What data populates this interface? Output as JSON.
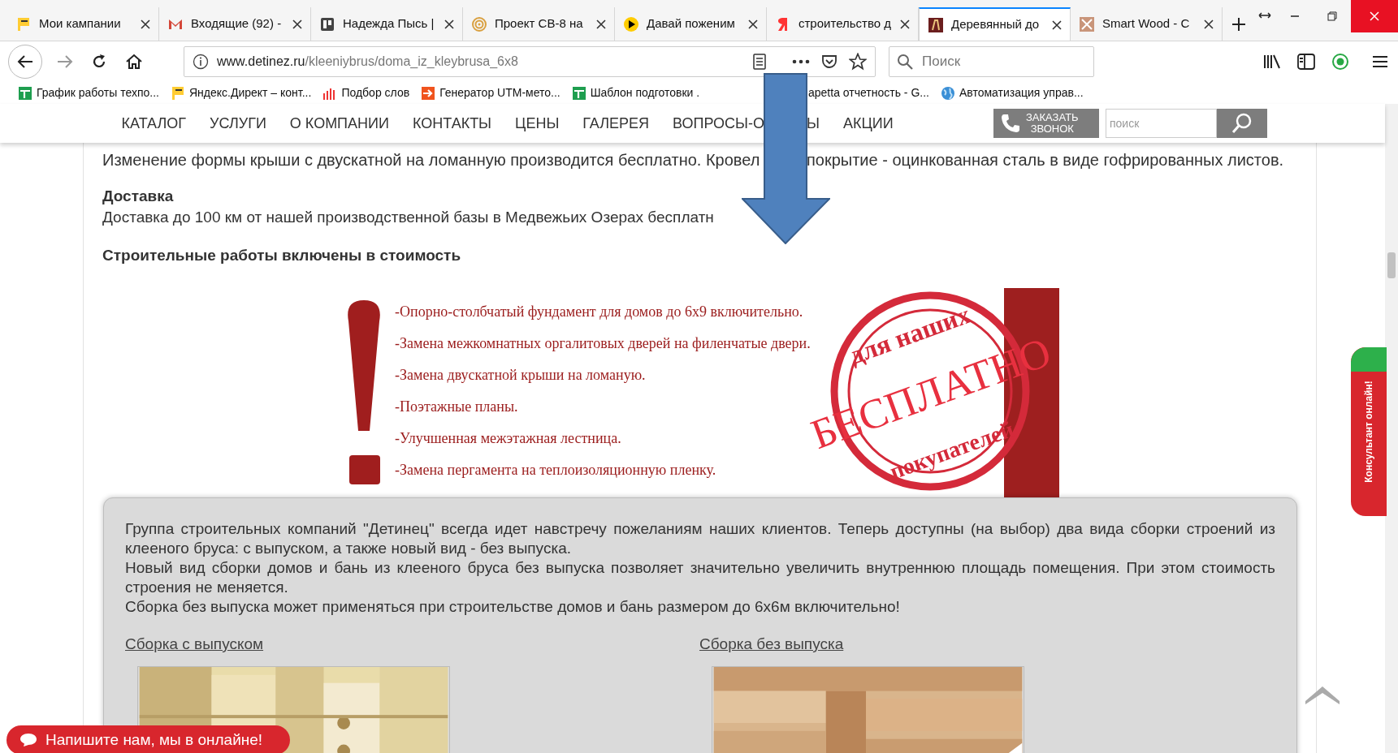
{
  "browser": {
    "tabs": [
      {
        "title": "Мои кампании",
        "kind": "flag",
        "selected": false
      },
      {
        "title": "Входящие (92) -",
        "kind": "mail",
        "selected": false
      },
      {
        "title": "Надежда Пысь |",
        "kind": "board",
        "selected": false
      },
      {
        "title": "Проект СВ-8 на",
        "kind": "rings",
        "selected": false
      },
      {
        "title": "Давай поженим",
        "kind": "play",
        "selected": false
      },
      {
        "title": "строительство д",
        "kind": "search",
        "selected": false
      },
      {
        "title": "Деревянный до",
        "kind": "brand",
        "selected": true
      },
      {
        "title": "Smart Wood - С",
        "kind": "wood",
        "selected": false
      }
    ],
    "url": {
      "host": "www.detinez.ru",
      "path": "/kleeniybrus/doma_iz_kleybrusa_6x8"
    },
    "search": {
      "placeholder": "Поиск"
    },
    "bookmarks": [
      {
        "title": "График работы техпо...",
        "kind": "sheet"
      },
      {
        "title": "Яндекс.Директ – конт...",
        "kind": "flag"
      },
      {
        "title": "Подбор слов",
        "kind": "bars"
      },
      {
        "title": "Генератор UTM-мето...",
        "kind": "arrow"
      },
      {
        "title": "Шаблон подготовки .",
        "kind": "sheet"
      },
      {
        "title": "apetta отчетность - G...",
        "kind": "none"
      },
      {
        "title": "Автоматизация управ...",
        "kind": "globe"
      }
    ]
  },
  "site": {
    "nav": [
      "КАТАЛОГ",
      "УСЛУГИ",
      "О КОМПАНИИ",
      "КОНТАКТЫ",
      "ЦЕНЫ",
      "ГАЛЕРЕЯ",
      "ВОПРОСЫ-О",
      "Ы",
      "АКЦИИ"
    ],
    "callback_button": [
      "ЗАКАЗАТЬ",
      "ЗВОНОК"
    ],
    "search": {
      "placeholder": "поиск"
    },
    "roof_text": [
      "Изменение формы крыши с двускатной на ломанную производится бесплатно. Кровел",
      "покрытие - оцинкованная сталь в виде гофрированных листов."
    ],
    "delivery_title": "Доставка",
    "delivery_text": "Доставка до 100 км от нашей производственной базы в Медвежьих Озерах бесплатн",
    "works_title": "Строительные работы включены в стоимость",
    "banner": {
      "items": [
        "-Опорно-столбчатый фундамент для домов до 6х9 включительно.",
        "-Замена межкомнатных оргалитовых дверей на филенчатые двери.",
        "-Замена двускатной крыши на ломаную.",
        "-Поэтажные планы.",
        "-Улучшенная межэтажная лестница.",
        "-Замена пергамента на теплоизоляционную пленку."
      ],
      "stamp_top": "для наших",
      "stamp_main": "БЕСПЛАТНО",
      "stamp_bottom": "покупателей"
    },
    "info": [
      "Группа строительных компаний \"Детинец\" всегда идет навстречу пожеланиям наших клиентов. Теперь доступны (на выбор) два вида сборки строений из клееного бруса: с выпуском, а также новый вид - без выпуска.",
      "Новый вид сборки домов и бань из клееного бруса без выпуска позволяет значительно увеличить внутреннюю площадь помещения. При этом стоимость строения не меняется.",
      "Сборка без выпуска может применяться при строительстве домов и бань размером до 6х6м включительно!"
    ],
    "options": [
      {
        "title": "Сборка с выпуском"
      },
      {
        "title": "Сборка без выпуска"
      }
    ],
    "chat_button": "Напишите нам, мы в онлайне!",
    "consultant_tab": "Консультант онлайн!"
  }
}
